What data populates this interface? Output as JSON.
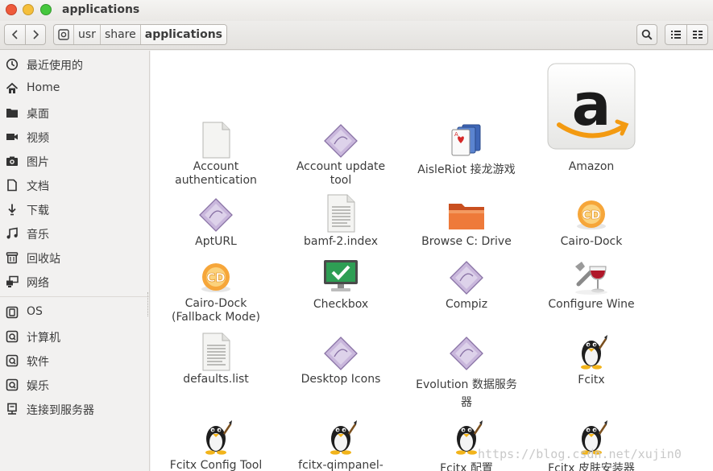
{
  "window": {
    "title": "applications"
  },
  "breadcrumbs": [
    "usr",
    "share",
    "applications"
  ],
  "sidebar": {
    "places": [
      {
        "label": "最近使用的",
        "icon": "recent-icon"
      },
      {
        "label": "Home",
        "icon": "home-icon"
      },
      {
        "label": "桌面",
        "icon": "folder-icon"
      },
      {
        "label": "视频",
        "icon": "video-icon"
      },
      {
        "label": "图片",
        "icon": "camera-icon"
      },
      {
        "label": "文档",
        "icon": "document-icon"
      },
      {
        "label": "下载",
        "icon": "download-icon"
      },
      {
        "label": "音乐",
        "icon": "music-icon"
      },
      {
        "label": "回收站",
        "icon": "trash-icon"
      },
      {
        "label": "网络",
        "icon": "network-icon"
      }
    ],
    "devices": [
      {
        "label": "OS",
        "icon": "drive-icon"
      },
      {
        "label": "计算机",
        "icon": "drive-icon"
      },
      {
        "label": "软件",
        "icon": "drive-icon"
      },
      {
        "label": "娱乐",
        "icon": "drive-icon"
      },
      {
        "label": "连接到服务器",
        "icon": "server-icon"
      }
    ]
  },
  "files": [
    {
      "label": "Account\nauthentication",
      "icon": "blank-file-icon"
    },
    {
      "label": "Account update\ntool",
      "icon": "diamond-app-icon"
    },
    {
      "label": "AisleRiot 接龙游戏",
      "icon": "cards-icon"
    },
    {
      "label": "Amazon",
      "icon": "amazon-icon"
    },
    {
      "label": "AptURL",
      "icon": "diamond-app-icon"
    },
    {
      "label": "bamf-2.index",
      "icon": "text-file-icon"
    },
    {
      "label": "Browse C: Drive",
      "icon": "orange-folder-icon"
    },
    {
      "label": "Cairo-Dock",
      "icon": "cairo-dock-icon"
    },
    {
      "label": "Cairo-Dock\n(Fallback Mode)",
      "icon": "cairo-dock-icon"
    },
    {
      "label": "Checkbox",
      "icon": "checkbox-monitor-icon"
    },
    {
      "label": "Compiz",
      "icon": "diamond-app-icon"
    },
    {
      "label": "Configure Wine",
      "icon": "wine-icon"
    },
    {
      "label": "defaults.list",
      "icon": "text-file-icon"
    },
    {
      "label": "Desktop Icons",
      "icon": "diamond-app-icon"
    },
    {
      "label": "Evolution 数据服务\n器",
      "icon": "diamond-app-icon"
    },
    {
      "label": "Fcitx",
      "icon": "penguin-icon"
    },
    {
      "label": "Fcitx Config Tool",
      "icon": "penguin-icon"
    },
    {
      "label": "fcitx-qimpanel-",
      "icon": "penguin-icon"
    },
    {
      "label": "Fcitx 配置",
      "icon": "penguin-icon"
    },
    {
      "label": "Fcitx 皮肤安装器",
      "icon": "penguin-icon"
    }
  ],
  "watermark": "https://blog.csdn.net/xujin0"
}
